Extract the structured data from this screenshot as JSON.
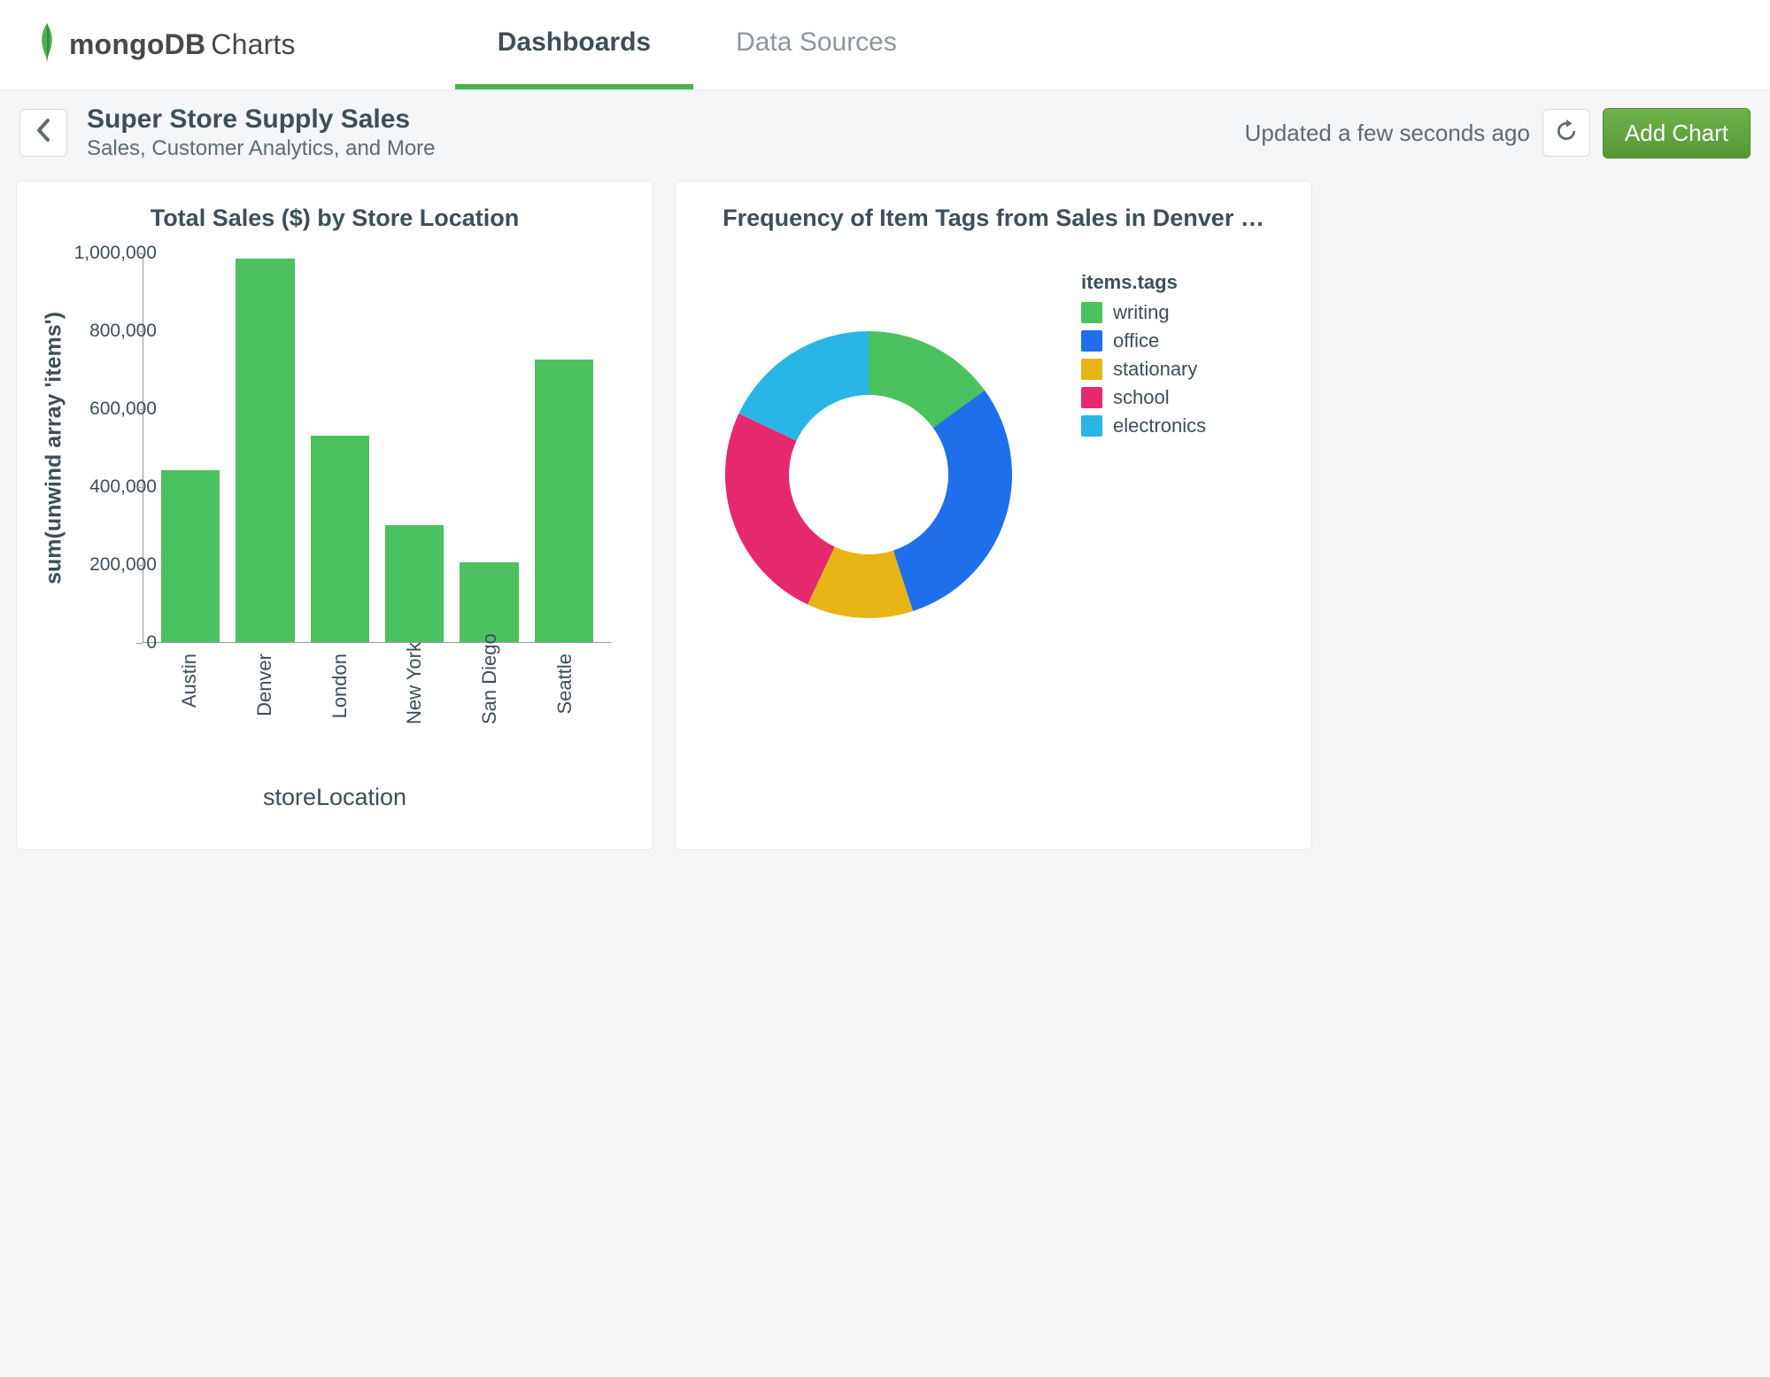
{
  "brand": {
    "primary": "mongoDB",
    "suffix": "Charts"
  },
  "nav": {
    "tabs": [
      {
        "label": "Dashboards",
        "active": true
      },
      {
        "label": "Data Sources",
        "active": false
      }
    ]
  },
  "header": {
    "title": "Super Store Supply Sales",
    "subtitle": "Sales, Customer Analytics, and More",
    "updated": "Updated a few seconds ago",
    "add_chart": "Add Chart"
  },
  "colors": {
    "bar": "#4cc160",
    "donut": {
      "writing": "#4cc160",
      "office": "#1f6feb",
      "stationary": "#e7b416",
      "school": "#e6286e",
      "electronics": "#29b6e6"
    },
    "accent_green": "#589636"
  },
  "chart_data": [
    {
      "id": "bar-sales",
      "type": "bar",
      "title": "Total Sales ($) by Store Location",
      "xlabel": "storeLocation",
      "ylabel": "sum(unwind array 'items')",
      "ylim": [
        0,
        1000000
      ],
      "yticks": [
        0,
        200000,
        400000,
        600000,
        800000,
        1000000
      ],
      "ytick_labels": [
        "0",
        "200,000",
        "400,000",
        "600,000",
        "800,000",
        "1,000,000"
      ],
      "categories": [
        "Austin",
        "Denver",
        "London",
        "New York",
        "San Diego",
        "Seattle"
      ],
      "values": [
        440000,
        985000,
        530000,
        300000,
        205000,
        725000
      ]
    },
    {
      "id": "donut-tags",
      "type": "pie",
      "title": "Frequency of Item Tags from Sales in Denver …",
      "legend_title": "items.tags",
      "series": [
        {
          "name": "writing",
          "value": 15,
          "color": "#4cc160"
        },
        {
          "name": "office",
          "value": 30,
          "color": "#1f6feb"
        },
        {
          "name": "stationary",
          "value": 12,
          "color": "#e7b416"
        },
        {
          "name": "school",
          "value": 25,
          "color": "#e6286e"
        },
        {
          "name": "electronics",
          "value": 18,
          "color": "#29b6e6"
        }
      ]
    }
  ]
}
